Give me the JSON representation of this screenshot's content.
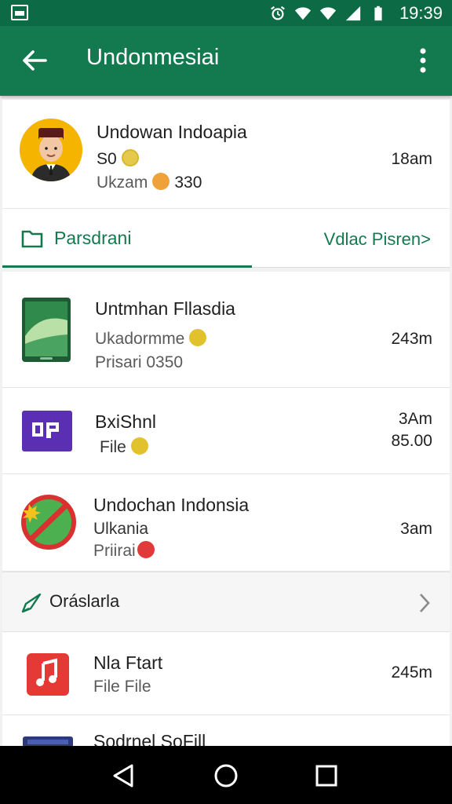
{
  "status_bar": {
    "time": "19:39",
    "icons": [
      "image-icon",
      "alarm-icon",
      "wifi-icon",
      "wifi-icon",
      "signal-icon",
      "battery-icon"
    ]
  },
  "app_bar": {
    "title": "Undonmesiai",
    "back_icon": "arrow-back-icon",
    "menu_icon": "more-vert-icon",
    "color": "#137a4f"
  },
  "profile": {
    "name": "Undowan Indoapia",
    "line1": "S0",
    "line2_label": "Ukzam",
    "line2_value": "330",
    "time": "18am",
    "avatar_icon": "person-avatar-icon"
  },
  "tabs": {
    "left_label": "Parsdrani",
    "right_label": "Vdlac Pisren>",
    "left_icon": "folder-icon"
  },
  "items": [
    {
      "title": "Untmhan Fllasdia",
      "sub1": "Ukadormme",
      "sub2": "Prisari  0350",
      "time": "243m",
      "icon": "tablet-app-icon"
    },
    {
      "title": "BxiShnl",
      "sub1": "File",
      "time": "3Am",
      "time2": "85.00",
      "icon": "purple-app-icon"
    },
    {
      "title": "Undochan Indonsia",
      "sub1": "Ulkania",
      "sub2": "Priirai",
      "time": "3am",
      "icon": "no-entry-badge-icon"
    }
  ],
  "section": {
    "label": "Oráslarla",
    "icon": "rocket-icon"
  },
  "items2": [
    {
      "title": "Nla Ftart",
      "sub1": "File File",
      "time": "245m",
      "icon": "music-note-icon"
    },
    {
      "title": "Sodrnel SoFill",
      "icon": "folder-app-icon"
    }
  ],
  "nav": {
    "back": "nav-back-icon",
    "home": "nav-home-icon",
    "recents": "nav-recents-icon"
  }
}
